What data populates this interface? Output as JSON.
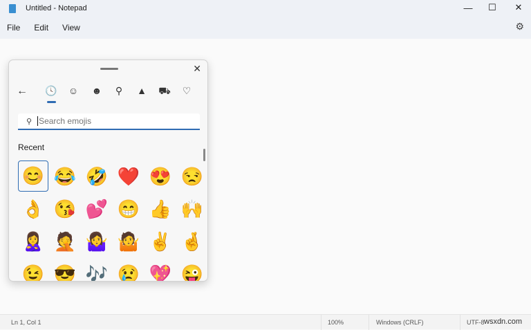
{
  "window": {
    "title": "Untitled - Notepad",
    "minimize": "—",
    "maximize": "☐",
    "close": "✕"
  },
  "menu": [
    "File",
    "Edit",
    "View"
  ],
  "status": {
    "position": "Ln 1, Col 1",
    "zoom": "100%",
    "line_ending": "Windows (CRLF)",
    "encoding": "UTF-8"
  },
  "watermark": "wsxdn.com",
  "emoji_panel": {
    "close": "✕",
    "back": "←",
    "tabs": [
      {
        "name": "recent",
        "glyph": "🕓"
      },
      {
        "name": "smileys",
        "glyph": "☺"
      },
      {
        "name": "people",
        "glyph": "☻"
      },
      {
        "name": "celebration",
        "glyph": "⚲"
      },
      {
        "name": "food",
        "glyph": "▲"
      },
      {
        "name": "travel",
        "glyph": "⛟"
      },
      {
        "name": "symbols",
        "glyph": "♡"
      }
    ],
    "search_placeholder": "Search emojis",
    "search_icon": "⚲",
    "section": "Recent",
    "emojis": [
      "😊",
      "😂",
      "🤣",
      "❤️",
      "😍",
      "😒",
      "👌",
      "😘",
      "💕",
      "😁",
      "👍",
      "🙌",
      "🙎‍♀️",
      "🤦",
      "🤷‍♀️",
      "🤷",
      "✌️",
      "🤞",
      "😉",
      "😎",
      "🎶",
      "😢",
      "💖",
      "😜"
    ]
  }
}
